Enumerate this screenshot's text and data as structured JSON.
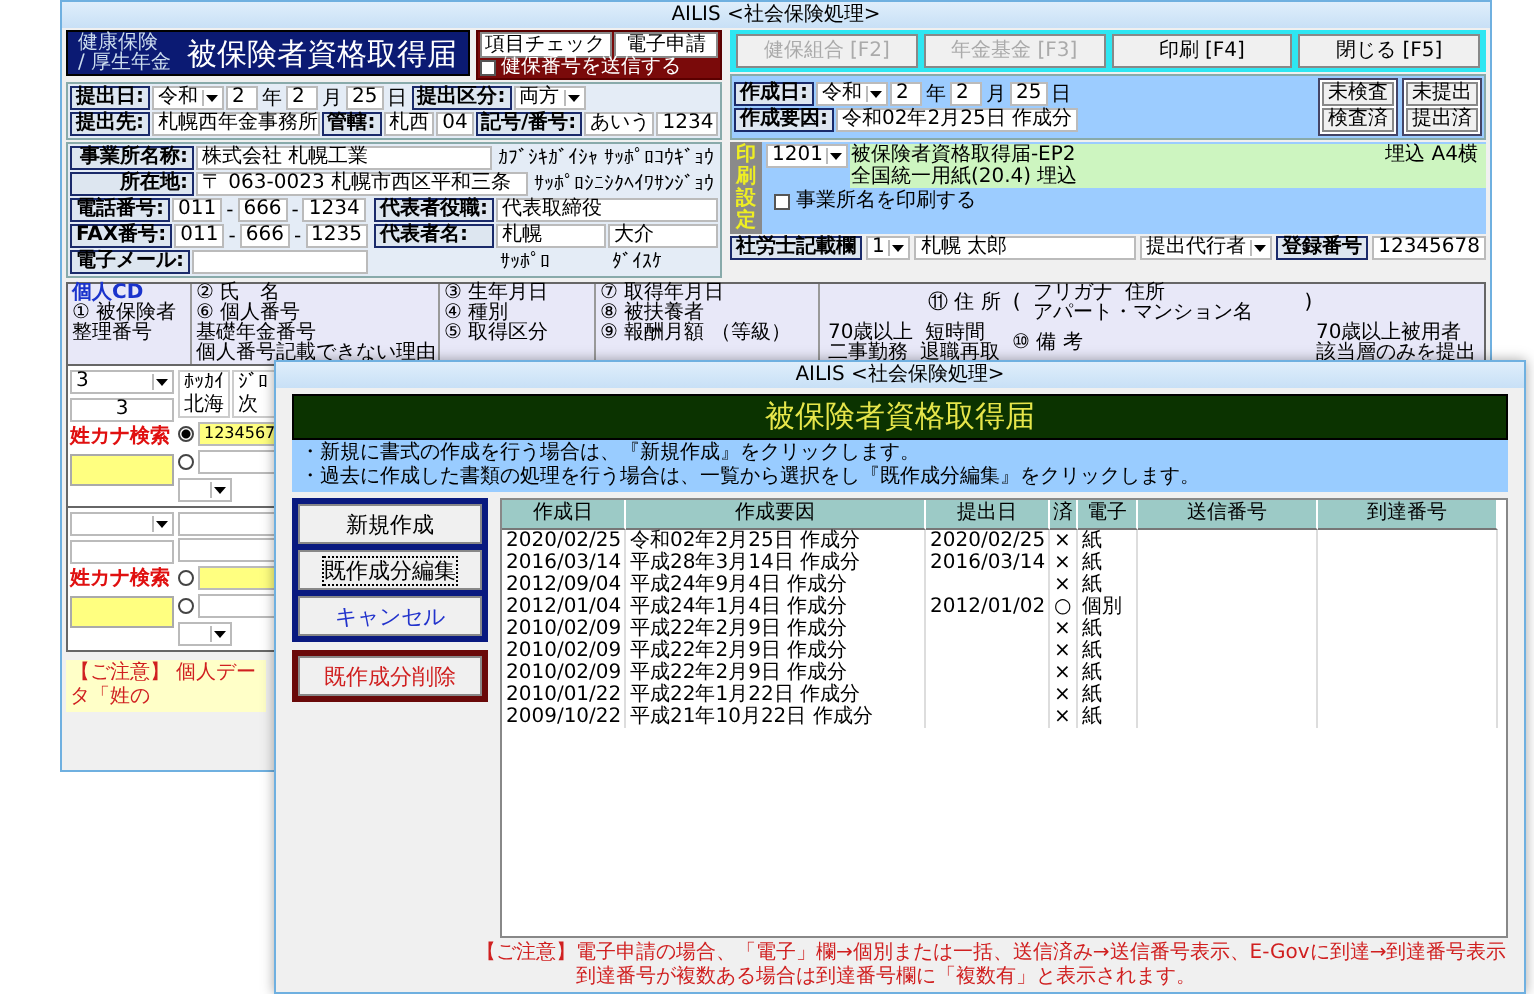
{
  "back_window": {
    "title": "AILIS <社会保険処理>",
    "form_category": [
      "健康保険",
      "/ 厚生年金"
    ],
    "form_title": "被保険者資格取得届",
    "check_buttons": [
      {
        "label": "項目チェック"
      },
      {
        "label": "電子申請"
      }
    ],
    "send_option": {
      "label": "健保番号を送信する",
      "checked": false
    },
    "function_buttons": [
      {
        "label": "健保組合 [F2]",
        "disabled": true
      },
      {
        "label": "年金基金 [F3]",
        "disabled": true
      },
      {
        "label": "印刷 [F4]",
        "disabled": false
      },
      {
        "label": "閉じる [F5]",
        "disabled": false
      }
    ],
    "submission_rows": [
      [
        {
          "kind": "label",
          "text": "提出日:"
        },
        {
          "kind": "select",
          "text": "令和"
        },
        {
          "kind": "value",
          "text": "2"
        },
        {
          "kind": "text",
          "text": "年"
        },
        {
          "kind": "value",
          "text": "2"
        },
        {
          "kind": "text",
          "text": "月"
        },
        {
          "kind": "value",
          "text": "25"
        },
        {
          "kind": "text",
          "text": "日"
        },
        {
          "kind": "label",
          "text": "提出区分:"
        },
        {
          "kind": "select",
          "text": "両方"
        }
      ],
      [
        {
          "kind": "label",
          "text": "提出先:"
        },
        {
          "kind": "value",
          "text": "札幌西年金事務所"
        },
        {
          "kind": "label",
          "text": "管轄:"
        },
        {
          "kind": "value",
          "text": "札西"
        },
        {
          "kind": "value",
          "text": "04"
        },
        {
          "kind": "label",
          "text": "記号/番号:"
        },
        {
          "kind": "value",
          "text": "あいう"
        },
        {
          "kind": "value",
          "text": "1234"
        }
      ]
    ],
    "creation_rows": [
      [
        {
          "kind": "label",
          "text": "作成日:"
        },
        {
          "kind": "select",
          "text": "令和"
        },
        {
          "kind": "value",
          "text": "2"
        },
        {
          "kind": "text",
          "text": "年"
        },
        {
          "kind": "value",
          "text": "2"
        },
        {
          "kind": "text",
          "text": "月"
        },
        {
          "kind": "value",
          "text": "25"
        },
        {
          "kind": "text",
          "text": "日"
        }
      ],
      [
        {
          "kind": "label",
          "text": "作成要因:"
        },
        {
          "kind": "value",
          "text": "令和02年2月25日 作成分"
        }
      ]
    ],
    "status_buttons": [
      [
        "未検査",
        "検査済"
      ],
      [
        "未提出",
        "提出済"
      ]
    ],
    "office_rows": [
      {
        "label": "事業所名称:",
        "value": "株式会社 札幌工業",
        "kana": "ｶﾌﾞｼｷｶﾞｲｼｬ ｻｯﾎﾟﾛｺｳｷﾞｮｳ"
      },
      {
        "label": "所在地:",
        "value": "〒 063-0023 札幌市西区平和三条",
        "kana": "ｻｯﾎﾟﾛｼﾆｼｸﾍｲﾜｻﾝｼﾞｮｳ"
      }
    ],
    "contact_rows": [
      [
        {
          "kind": "label",
          "text": "電話番号:"
        },
        {
          "kind": "value",
          "text": "011"
        },
        {
          "kind": "text",
          "text": "-"
        },
        {
          "kind": "value",
          "text": "666"
        },
        {
          "kind": "text",
          "text": "-"
        },
        {
          "kind": "value",
          "text": "1234"
        }
      ],
      [
        {
          "kind": "label",
          "text": "FAX番号:"
        },
        {
          "kind": "value",
          "text": "011"
        },
        {
          "kind": "text",
          "text": "-"
        },
        {
          "kind": "value",
          "text": "666"
        },
        {
          "kind": "text",
          "text": "-"
        },
        {
          "kind": "value",
          "text": "1235"
        }
      ],
      [
        {
          "kind": "label",
          "text": "電子メール:"
        },
        {
          "kind": "blank"
        }
      ]
    ],
    "representative": {
      "title_label": "代表者役職:",
      "title": "代表取締役",
      "name_label": "代表者名:",
      "family_name": "札幌",
      "given_name": "大介",
      "family_kana": "ｻｯﾎﾟﾛ",
      "given_kana": "ﾀﾞｲｽｹ"
    },
    "print_settings": {
      "label": "印刷設定",
      "form_code": "1201",
      "form_name": "被保険者資格取得届-EP2",
      "form_embed": "埋込 A4横",
      "paper": "全国統一用紙(20.4) 埋込",
      "print_office": {
        "label": "事業所名を印刷する",
        "checked": false
      }
    },
    "agent": {
      "label": "社労士記載欄",
      "number": "1",
      "name": "札幌 太郎",
      "role": "提出代行者",
      "reg_label": "登録番号",
      "reg_number": "12345678"
    },
    "header_columns": [
      [
        "個人CD",
        "① 被保険者",
        "整理番号"
      ],
      [
        "② 氏　名",
        "⑥ 個人番号",
        "基礎年金番号",
        "個人番号記載できない理由"
      ],
      [
        "③ 生年月日",
        "④ 種別",
        "⑤ 取得区分"
      ],
      [
        "⑦ 取得年月日",
        "⑧ 被扶養者",
        "⑨ 報酬月額 （等級）"
      ]
    ],
    "address_header": {
      "label": "⑪ 住 所",
      "paren_open": "(",
      "kana_notes": [
        "フリガナ",
        "住所",
        "アパート・マンション名"
      ],
      "paren_close": ")",
      "flags": [
        [
          "70歳以上",
          "短時間"
        ],
        [
          "二事勤務",
          "退職再取"
        ]
      ],
      "remarks": "⑩ 備 考",
      "senior_note": [
        "70歳以上被用者",
        "該当層のみを提出"
      ]
    },
    "people": [
      {
        "number_select": "3",
        "number": "3",
        "search_label": "姓カナ検索",
        "kana": [
          "ﾎｯｶｲ",
          "ｼﾞﾛ"
        ],
        "name": [
          "北海",
          "次"
        ],
        "id_options": [
          {
            "selected": true,
            "value": "1234567"
          },
          {
            "selected": false
          }
        ]
      },
      {
        "search_label": "姓カナ検索",
        "id_options": [
          {
            "selected": false
          },
          {
            "selected": false
          }
        ]
      }
    ],
    "notice": "【ご注意】 個人データ「姓の"
  },
  "dialog": {
    "title": "AILIS <社会保険処理>",
    "heading": "被保険者資格取得届",
    "instructions": [
      "・新規に書式の作成を行う場合は、『新規作成』をクリックします。",
      "・過去に作成した書類の処理を行う場合は、一覧から選択をし『既作成分編集』をクリックします。"
    ],
    "buttons": [
      {
        "label": "新規作成",
        "kind": "primary"
      },
      {
        "label": "既作成分編集",
        "kind": "focused"
      },
      {
        "label": "キャンセル",
        "kind": "cancel"
      },
      {
        "label": "既作成分削除",
        "kind": "danger"
      }
    ],
    "table": {
      "columns": [
        "作成日",
        "作成要因",
        "提出日",
        "済",
        "電子",
        "送信番号",
        "到達番号"
      ],
      "rows": [
        [
          "2020/02/25",
          "令和02年2月25日 作成分",
          "2020/02/25",
          "×",
          "紙"
        ],
        [
          "2016/03/14",
          "平成28年3月14日 作成分",
          "2016/03/14",
          "×",
          "紙"
        ],
        [
          "2012/09/04",
          "平成24年9月4日 作成分",
          "",
          "×",
          "紙"
        ],
        [
          "2012/01/04",
          "平成24年1月4日 作成分",
          "2012/01/02",
          "○",
          "個別"
        ],
        [
          "2010/02/09",
          "平成22年2月9日 作成分",
          "",
          "×",
          "紙"
        ],
        [
          "2010/02/09",
          "平成22年2月9日 作成分",
          "",
          "×",
          "紙"
        ],
        [
          "2010/02/09",
          "平成22年2月9日 作成分",
          "",
          "×",
          "紙"
        ],
        [
          "2010/01/22",
          "平成22年1月22日 作成分",
          "",
          "×",
          "紙"
        ],
        [
          "2009/10/22",
          "平成21年10月22日 作成分",
          "",
          "×",
          "紙"
        ]
      ]
    },
    "note": [
      "【ご注意】電子申請の場合、「電子」欄→個別または一括、送信済み→送信番号表示、E-Govに到達→到達番号表示",
      "到達番号が複数ある場合は到達番号欄に「複数有」と表示されます。"
    ]
  }
}
